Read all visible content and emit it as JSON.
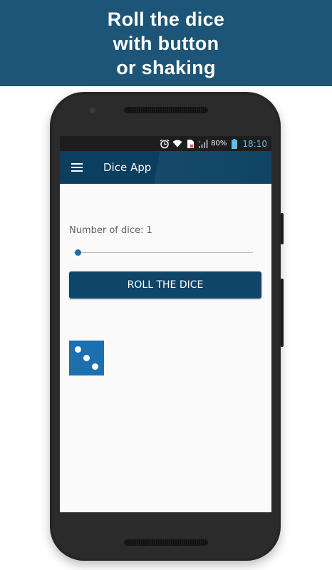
{
  "promo": {
    "line1": "Roll the dice",
    "line2": "with button",
    "line3": "or shaking"
  },
  "status_bar": {
    "icons": [
      "alarm-icon",
      "wifi-icon",
      "sim-card-icon",
      "signal-icon",
      "battery-icon"
    ],
    "battery_percent": "80%",
    "time": "18:10"
  },
  "app_bar": {
    "menu_icon": "hamburger-menu-icon",
    "title": "Dice App"
  },
  "main": {
    "dice_count_label": "Number of dice: 1",
    "slider_value": 1,
    "roll_button_label": "ROLL THE DICE",
    "dice_values": [
      3
    ]
  },
  "colors": {
    "promo_background": "#1c5577",
    "app_bar": "#0b3f60",
    "button": "#0e4569",
    "die": "#1d70b0",
    "accent": "#1b6fa6",
    "status_time": "#5ec2e6"
  }
}
